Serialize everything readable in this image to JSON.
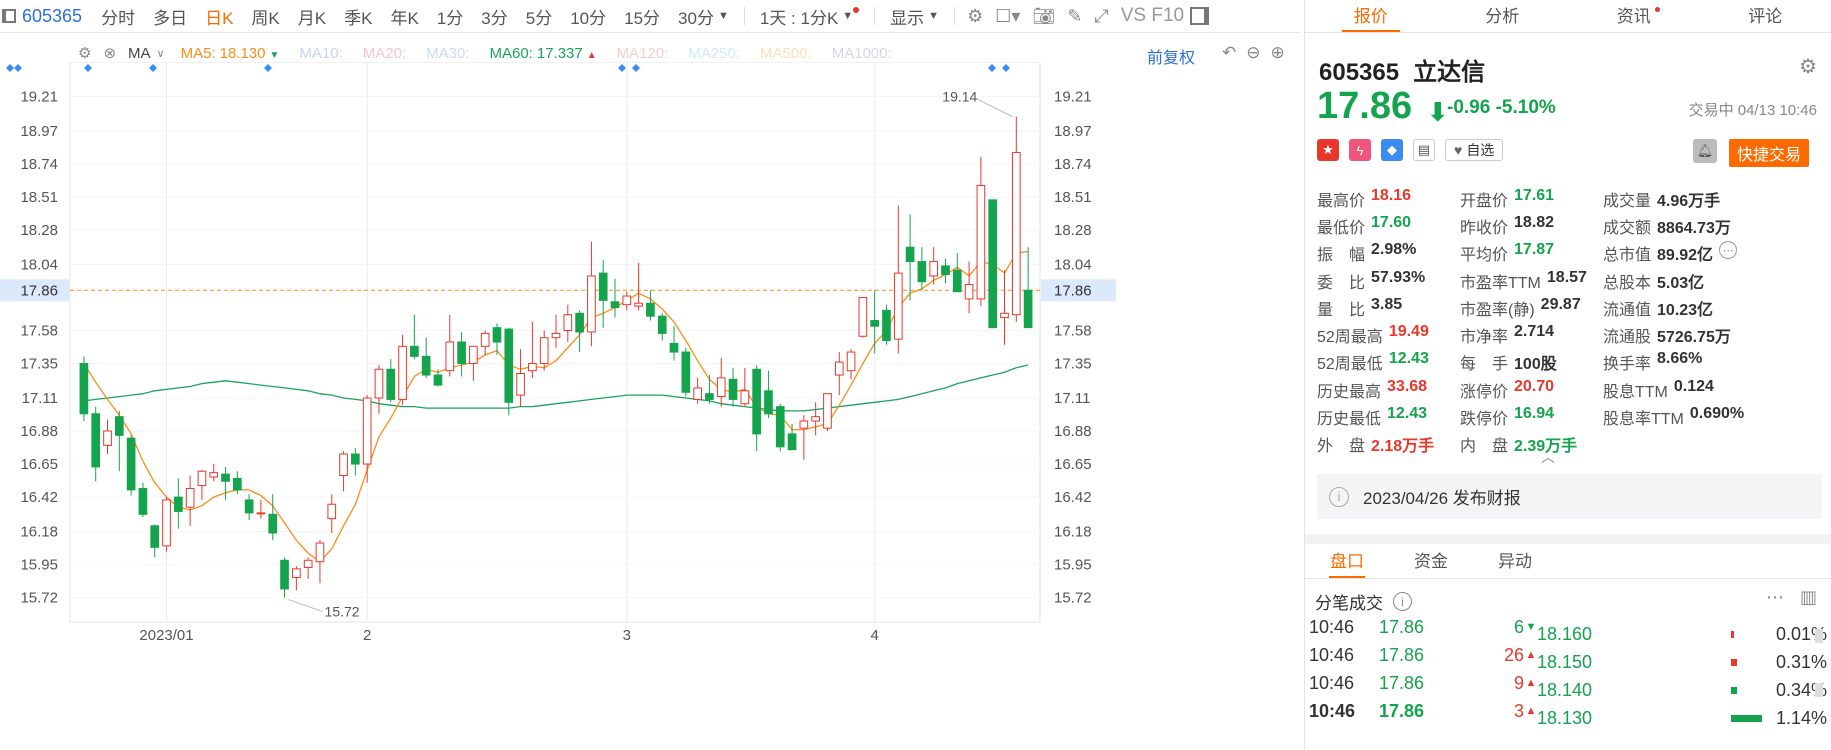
{
  "toolbar": {
    "symbol": "605365",
    "tabs": [
      {
        "label": "分时",
        "active": false
      },
      {
        "label": "多日",
        "active": false
      },
      {
        "label": "日K",
        "active": true
      },
      {
        "label": "周K",
        "active": false
      },
      {
        "label": "月K",
        "active": false
      },
      {
        "label": "季K",
        "active": false
      },
      {
        "label": "年K",
        "active": false
      },
      {
        "label": "1分",
        "active": false
      },
      {
        "label": "3分",
        "active": false
      },
      {
        "label": "5分",
        "active": false
      },
      {
        "label": "10分",
        "active": false
      },
      {
        "label": "15分",
        "active": false
      }
    ],
    "dd30": "30分",
    "dd_period": "1天 : 1分K",
    "display": "显示",
    "vsf10": "VS F10"
  },
  "ma": {
    "label": "MA",
    "items": [
      {
        "name": "MA5:",
        "value": "18.130",
        "color": "#ff8c1a",
        "arrow": "down"
      },
      {
        "name": "MA10:",
        "value": "",
        "color": "#c7d7ef"
      },
      {
        "name": "MA20:",
        "value": "",
        "color": "#f2c6d6"
      },
      {
        "name": "MA30:",
        "value": "",
        "color": "#c9dcef"
      },
      {
        "name": "MA60:",
        "value": "17.337",
        "color": "#1aa35c",
        "arrow": "up"
      },
      {
        "name": "MA120:",
        "value": "",
        "color": "#f6cdcd"
      },
      {
        "name": "MA250:",
        "value": "",
        "color": "#cdebf4"
      },
      {
        "name": "MA500:",
        "value": "",
        "color": "#f7e3b5"
      },
      {
        "name": "MA1000:",
        "value": "",
        "color": "#d6d4ec"
      }
    ],
    "adjust": "前复权"
  },
  "chart_data": {
    "type": "candlestick",
    "y_ticks": [
      "19.21",
      "18.97",
      "18.74",
      "18.51",
      "18.28",
      "18.04",
      "17.86",
      "17.58",
      "17.35",
      "17.11",
      "16.88",
      "16.65",
      "16.42",
      "16.18",
      "15.95",
      "15.72"
    ],
    "current_price_label": "17.86",
    "x_labels": [
      "2023/01",
      "2",
      "3",
      "4"
    ],
    "annotations": {
      "high": "19.14",
      "low": "15.72"
    },
    "ylim": [
      15.55,
      19.45
    ],
    "candles": [
      {
        "o": 17.35,
        "c": 17.0,
        "h": 17.4,
        "l": 16.95
      },
      {
        "o": 17.0,
        "c": 16.63,
        "h": 17.05,
        "l": 16.53
      },
      {
        "o": 16.78,
        "c": 16.88,
        "h": 16.96,
        "l": 16.72
      },
      {
        "o": 16.98,
        "c": 16.85,
        "h": 17.02,
        "l": 16.6
      },
      {
        "o": 16.83,
        "c": 16.47,
        "h": 16.85,
        "l": 16.43
      },
      {
        "o": 16.48,
        "c": 16.3,
        "h": 16.52,
        "l": 16.28
      },
      {
        "o": 16.22,
        "c": 16.07,
        "h": 16.23,
        "l": 16.0
      },
      {
        "o": 16.08,
        "c": 16.4,
        "h": 16.42,
        "l": 16.04
      },
      {
        "o": 16.42,
        "c": 16.32,
        "h": 16.55,
        "l": 16.2
      },
      {
        "o": 16.35,
        "c": 16.48,
        "h": 16.57,
        "l": 16.22
      },
      {
        "o": 16.5,
        "c": 16.6,
        "h": 16.61,
        "l": 16.4
      },
      {
        "o": 16.56,
        "c": 16.59,
        "h": 16.65,
        "l": 16.53
      },
      {
        "o": 16.58,
        "c": 16.53,
        "h": 16.63,
        "l": 16.4
      },
      {
        "o": 16.55,
        "c": 16.47,
        "h": 16.6,
        "l": 16.44
      },
      {
        "o": 16.4,
        "c": 16.31,
        "h": 16.44,
        "l": 16.26
      },
      {
        "o": 16.31,
        "c": 16.31,
        "h": 16.4,
        "l": 16.27
      },
      {
        "o": 16.3,
        "c": 16.17,
        "h": 16.44,
        "l": 16.12
      },
      {
        "o": 15.98,
        "c": 15.78,
        "h": 16.0,
        "l": 15.72
      },
      {
        "o": 15.86,
        "c": 15.92,
        "h": 15.94,
        "l": 15.77
      },
      {
        "o": 15.93,
        "c": 15.98,
        "h": 16.0,
        "l": 15.85
      },
      {
        "o": 15.97,
        "c": 16.1,
        "h": 16.12,
        "l": 15.82
      },
      {
        "o": 16.27,
        "c": 16.37,
        "h": 16.44,
        "l": 16.17
      },
      {
        "o": 16.57,
        "c": 16.72,
        "h": 16.74,
        "l": 16.46
      },
      {
        "o": 16.72,
        "c": 16.65,
        "h": 16.76,
        "l": 16.57
      },
      {
        "o": 16.65,
        "c": 17.11,
        "h": 17.13,
        "l": 16.52
      },
      {
        "o": 17.11,
        "c": 17.31,
        "h": 17.34,
        "l": 17.0
      },
      {
        "o": 17.31,
        "c": 17.1,
        "h": 17.38,
        "l": 17.08
      },
      {
        "o": 17.1,
        "c": 17.47,
        "h": 17.55,
        "l": 17.06
      },
      {
        "o": 17.47,
        "c": 17.4,
        "h": 17.69,
        "l": 17.38
      },
      {
        "o": 17.4,
        "c": 17.27,
        "h": 17.53,
        "l": 17.25
      },
      {
        "o": 17.27,
        "c": 17.2,
        "h": 17.31,
        "l": 17.19
      },
      {
        "o": 17.3,
        "c": 17.5,
        "h": 17.69,
        "l": 17.26
      },
      {
        "o": 17.5,
        "c": 17.35,
        "h": 17.57,
        "l": 17.26
      },
      {
        "o": 17.35,
        "c": 17.47,
        "h": 17.47,
        "l": 17.23
      },
      {
        "o": 17.47,
        "c": 17.56,
        "h": 17.58,
        "l": 17.41
      },
      {
        "o": 17.6,
        "c": 17.5,
        "h": 17.63,
        "l": 17.41
      },
      {
        "o": 17.59,
        "c": 17.08,
        "h": 17.6,
        "l": 16.99
      },
      {
        "o": 17.13,
        "c": 17.28,
        "h": 17.45,
        "l": 17.05
      },
      {
        "o": 17.3,
        "c": 17.35,
        "h": 17.64,
        "l": 17.25
      },
      {
        "o": 17.35,
        "c": 17.53,
        "h": 17.58,
        "l": 17.3
      },
      {
        "o": 17.53,
        "c": 17.56,
        "h": 17.69,
        "l": 17.46
      },
      {
        "o": 17.58,
        "c": 17.69,
        "h": 17.76,
        "l": 17.5
      },
      {
        "o": 17.7,
        "c": 17.57,
        "h": 17.72,
        "l": 17.43
      },
      {
        "o": 17.57,
        "c": 17.96,
        "h": 18.2,
        "l": 17.47
      },
      {
        "o": 17.98,
        "c": 17.79,
        "h": 18.07,
        "l": 17.6
      },
      {
        "o": 17.78,
        "c": 17.74,
        "h": 17.94,
        "l": 17.67
      },
      {
        "o": 17.76,
        "c": 17.82,
        "h": 17.85,
        "l": 17.72
      },
      {
        "o": 17.75,
        "c": 17.77,
        "h": 18.05,
        "l": 17.72
      },
      {
        "o": 17.77,
        "c": 17.68,
        "h": 17.86,
        "l": 17.65
      },
      {
        "o": 17.68,
        "c": 17.56,
        "h": 17.7,
        "l": 17.51
      },
      {
        "o": 17.49,
        "c": 17.43,
        "h": 17.61,
        "l": 17.37
      },
      {
        "o": 17.43,
        "c": 17.15,
        "h": 17.46,
        "l": 17.12
      },
      {
        "o": 17.1,
        "c": 17.18,
        "h": 17.25,
        "l": 17.07
      },
      {
        "o": 17.14,
        "c": 17.1,
        "h": 17.27,
        "l": 17.07
      },
      {
        "o": 17.12,
        "c": 17.25,
        "h": 17.39,
        "l": 17.05
      },
      {
        "o": 17.24,
        "c": 17.1,
        "h": 17.32,
        "l": 17.05
      },
      {
        "o": 17.07,
        "c": 17.16,
        "h": 17.32,
        "l": 17.05
      },
      {
        "o": 17.31,
        "c": 16.86,
        "h": 17.34,
        "l": 16.74
      },
      {
        "o": 17.16,
        "c": 17.0,
        "h": 17.3,
        "l": 16.97
      },
      {
        "o": 17.05,
        "c": 16.77,
        "h": 17.07,
        "l": 16.74
      },
      {
        "o": 16.86,
        "c": 16.75,
        "h": 16.93,
        "l": 16.75
      },
      {
        "o": 16.9,
        "c": 16.95,
        "h": 16.99,
        "l": 16.68
      },
      {
        "o": 16.95,
        "c": 16.98,
        "h": 17.08,
        "l": 16.85
      },
      {
        "o": 16.9,
        "c": 17.14,
        "h": 17.14,
        "l": 16.88
      },
      {
        "o": 17.27,
        "c": 17.36,
        "h": 17.43,
        "l": 17.13
      },
      {
        "o": 17.3,
        "c": 17.43,
        "h": 17.45,
        "l": 17.24
      },
      {
        "o": 17.54,
        "c": 17.81,
        "h": 17.81,
        "l": 17.53
      },
      {
        "o": 17.65,
        "c": 17.61,
        "h": 17.86,
        "l": 17.42
      },
      {
        "o": 17.72,
        "c": 17.51,
        "h": 17.76,
        "l": 17.48
      },
      {
        "o": 17.52,
        "c": 17.98,
        "h": 18.45,
        "l": 17.42
      },
      {
        "o": 18.16,
        "c": 18.06,
        "h": 18.39,
        "l": 17.79
      },
      {
        "o": 18.06,
        "c": 17.92,
        "h": 18.16,
        "l": 17.86
      },
      {
        "o": 17.96,
        "c": 18.06,
        "h": 18.16,
        "l": 17.9
      },
      {
        "o": 18.03,
        "c": 17.97,
        "h": 18.08,
        "l": 17.91
      },
      {
        "o": 18.0,
        "c": 17.85,
        "h": 18.12,
        "l": 17.85
      },
      {
        "o": 17.8,
        "c": 17.9,
        "h": 18.06,
        "l": 17.7
      },
      {
        "o": 17.8,
        "c": 18.59,
        "h": 18.79,
        "l": 17.75
      },
      {
        "o": 18.49,
        "c": 17.6,
        "h": 18.49,
        "l": 17.6
      },
      {
        "o": 17.67,
        "c": 17.7,
        "h": 18.0,
        "l": 17.48
      },
      {
        "o": 17.69,
        "c": 18.82,
        "h": 19.07,
        "l": 17.64
      },
      {
        "o": 17.86,
        "c": 17.6,
        "h": 18.16,
        "l": 17.6
      }
    ],
    "ma5": [
      17.35,
      17.22,
      17.1,
      16.99,
      16.86,
      16.67,
      16.52,
      16.42,
      16.35,
      16.33,
      16.36,
      16.42,
      16.45,
      16.47,
      16.47,
      16.43,
      16.36,
      16.24,
      16.12,
      16.03,
      15.97,
      16.06,
      16.22,
      16.37,
      16.61,
      16.84,
      16.97,
      17.12,
      17.26,
      17.31,
      17.29,
      17.32,
      17.34,
      17.36,
      17.41,
      17.44,
      17.34,
      17.31,
      17.33,
      17.32,
      17.37,
      17.46,
      17.55,
      17.67,
      17.7,
      17.74,
      17.79,
      17.84,
      17.8,
      17.73,
      17.64,
      17.51,
      17.37,
      17.24,
      17.17,
      17.15,
      17.17,
      17.05,
      17.0,
      16.99,
      16.89,
      16.89,
      16.91,
      16.93,
      17.06,
      17.2,
      17.35,
      17.49,
      17.58,
      17.74,
      17.84,
      17.87,
      17.93,
      17.97,
      18.02,
      17.96,
      18.06,
      18.04,
      17.98,
      18.12,
      18.13
    ],
    "ma60": [
      17.09,
      17.1,
      17.11,
      17.12,
      17.13,
      17.14,
      17.16,
      17.17,
      17.18,
      17.19,
      17.21,
      17.22,
      17.23,
      17.22,
      17.21,
      17.2,
      17.19,
      17.18,
      17.17,
      17.16,
      17.14,
      17.13,
      17.11,
      17.1,
      17.09,
      17.07,
      17.06,
      17.05,
      17.05,
      17.04,
      17.04,
      17.04,
      17.04,
      17.04,
      17.04,
      17.04,
      17.04,
      17.05,
      17.05,
      17.06,
      17.07,
      17.08,
      17.09,
      17.1,
      17.11,
      17.12,
      17.13,
      17.13,
      17.13,
      17.13,
      17.12,
      17.11,
      17.1,
      17.09,
      17.07,
      17.06,
      17.05,
      17.04,
      17.03,
      17.02,
      17.02,
      17.02,
      17.03,
      17.04,
      17.05,
      17.06,
      17.07,
      17.08,
      17.09,
      17.1,
      17.12,
      17.14,
      17.16,
      17.18,
      17.21,
      17.23,
      17.25,
      17.27,
      17.29,
      17.32,
      17.34
    ]
  },
  "quote": {
    "code": "605365",
    "name": "立达信",
    "price": "17.86",
    "change": "-0.96",
    "change_pct": "-5.10%",
    "status": "交易中 04/13 10:46",
    "watch": "自选",
    "trade": "快捷交易",
    "stats": [
      [
        {
          "k": "最高价",
          "v": "18.16",
          "c": "#e8382c"
        },
        {
          "k": "开盘价",
          "v": "17.61",
          "c": "#14a44d"
        },
        {
          "k": "成交量",
          "v": "4.96万手",
          "c": "#333"
        }
      ],
      [
        {
          "k": "最低价",
          "v": "17.60",
          "c": "#14a44d"
        },
        {
          "k": "昨收价",
          "v": "18.82",
          "c": "#333"
        },
        {
          "k": "成交额",
          "v": "8864.73万",
          "c": "#333"
        }
      ],
      [
        {
          "k": "振　幅",
          "v": "2.98%",
          "c": "#333"
        },
        {
          "k": "平均价",
          "v": "17.87",
          "c": "#14a44d"
        },
        {
          "k": "总市值",
          "v": "89.92亿",
          "c": "#333"
        }
      ],
      [
        {
          "k": "委　比",
          "v": "57.93%",
          "c": "#333"
        },
        {
          "k": "市盈率TTM",
          "v": "18.57",
          "c": "#333"
        },
        {
          "k": "总股本",
          "v": "5.03亿",
          "c": "#333"
        }
      ],
      [
        {
          "k": "量　比",
          "v": "3.85",
          "c": "#333"
        },
        {
          "k": "市盈率(静)",
          "v": "29.87",
          "c": "#333"
        },
        {
          "k": "流通值",
          "v": "10.23亿",
          "c": "#333"
        }
      ],
      [
        {
          "k": "52周最高",
          "v": "19.49",
          "c": "#e8382c"
        },
        {
          "k": "市净率",
          "v": "2.714",
          "c": "#333"
        },
        {
          "k": "流通股",
          "v": "5726.75万",
          "c": "#333"
        }
      ],
      [
        {
          "k": "52周最低",
          "v": "12.43",
          "c": "#14a44d"
        },
        {
          "k": "每　手",
          "v": "100股",
          "c": "#333"
        },
        {
          "k": "换手率",
          "v": "8.66%",
          "c": "#333"
        }
      ],
      [
        {
          "k": "历史最高",
          "v": "33.68",
          "c": "#e8382c"
        },
        {
          "k": "涨停价",
          "v": "20.70",
          "c": "#e8382c"
        },
        {
          "k": "股息TTM",
          "v": "0.124",
          "c": "#333"
        }
      ],
      [
        {
          "k": "历史最低",
          "v": "12.43",
          "c": "#14a44d"
        },
        {
          "k": "跌停价",
          "v": "16.94",
          "c": "#14a44d"
        },
        {
          "k": "股息率TTM",
          "v": "0.690%",
          "c": "#333"
        }
      ],
      [
        {
          "k": "外　盘",
          "v": "2.18万手",
          "c": "#e8382c"
        },
        {
          "k": "内　盘",
          "v": "2.39万手",
          "c": "#14a44d"
        },
        {
          "k": "",
          "v": "",
          "c": "#333"
        }
      ]
    ],
    "report": "2023/04/26  发布财报"
  },
  "rtabs": [
    "报价",
    "分析",
    "资讯",
    "评论"
  ],
  "subtabs": [
    "盘口",
    "资金",
    "异动"
  ],
  "ticks": {
    "title": "分笔成交",
    "rows": [
      {
        "time": "10:46",
        "price": "17.86",
        "vol": "6",
        "dir": "down"
      },
      {
        "time": "10:46",
        "price": "17.86",
        "vol": "26",
        "dir": "up"
      },
      {
        "time": "10:46",
        "price": "17.86",
        "vol": "9",
        "dir": "up"
      },
      {
        "time": "10:46",
        "price": "17.86",
        "vol": "3",
        "dir": "up"
      }
    ]
  },
  "book": {
    "rows": [
      {
        "price": "18.160",
        "pct": "0.01%",
        "fill": 0.02,
        "color": "#e8382c"
      },
      {
        "price": "18.150",
        "pct": "0.31%",
        "fill": 0.05,
        "color": "#e8382c"
      },
      {
        "price": "18.140",
        "pct": "0.34%",
        "fill": 0.05,
        "color": "#14a44d"
      },
      {
        "price": "18.130",
        "pct": "1.14%",
        "fill": 0.28,
        "color": "#14a44d"
      }
    ]
  }
}
